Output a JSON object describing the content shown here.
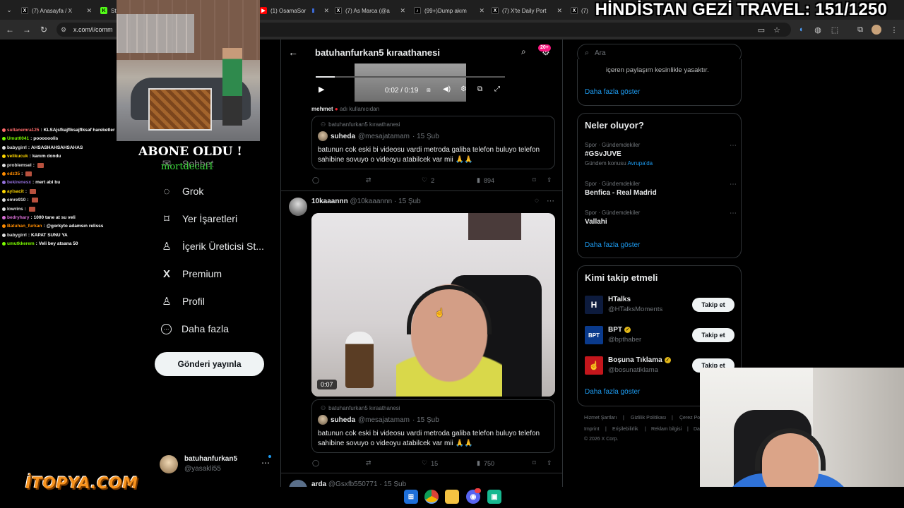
{
  "browser": {
    "tabs": [
      {
        "title": "(7) Anasayfa / X",
        "icon": "x-icon",
        "color": "#000000",
        "glyph": "X"
      },
      {
        "title": "St",
        "icon": "kick-icon",
        "color": "#53fc18",
        "glyph": "K"
      },
      {
        "title": "(1) OsamaSor",
        "icon": "youtube-icon",
        "color": "#ff0000",
        "glyph": "▶"
      },
      {
        "title": "(7) As Marca (@a",
        "icon": "x-icon",
        "color": "#000000",
        "glyph": "X"
      },
      {
        "title": "(99+)Dump akım",
        "icon": "tiktok-icon",
        "color": "#000000",
        "glyph": "♪"
      },
      {
        "title": "(7) X'te Daily Port",
        "icon": "x-icon",
        "color": "#000000",
        "glyph": "X"
      },
      {
        "title": "(7)",
        "icon": "x-icon",
        "color": "#000000",
        "glyph": "X"
      }
    ],
    "url": "x.com/i/comm"
  },
  "overlay": {
    "stream_title": "HİNDİSTAN GEZİ TRAVEL: 151/1250",
    "abone_text": "ABONE OLDU !",
    "abone_name": "mortdecai1",
    "brand_logo": "İTOPYA.COM"
  },
  "chat": [
    {
      "user": "sultanemra125",
      "msg": "KLSAjsfkajflksajflksaf hareketler",
      "color": "#ff6b6b",
      "emote": false
    },
    {
      "user": "Umut0041",
      "msg": "poooooolis",
      "color": "#7cfc00",
      "emote": false
    },
    {
      "user": "babygirrl",
      "msg": "AHSASHAHSAHSAHAS",
      "color": "#e0e0e0",
      "emote": false
    },
    {
      "user": "velikucuk",
      "msg": "kanım dondu",
      "color": "#ffd700",
      "emote": false
    },
    {
      "user": "problemsel",
      "msg": "",
      "color": "#e0e0e0",
      "emote": true
    },
    {
      "user": "edz35",
      "msg": "",
      "color": "#ff8c00",
      "emote": true
    },
    {
      "user": "bekirenesx",
      "msg": "mert abi bu",
      "color": "#9370db",
      "emote": false
    },
    {
      "user": "ayisacit",
      "msg": "",
      "color": "#ffd700",
      "emote": true
    },
    {
      "user": "emre910",
      "msg": "",
      "color": "#e0e0e0",
      "emote": true
    },
    {
      "user": "lowrins",
      "msg": "",
      "color": "#e0e0e0",
      "emote": true
    },
    {
      "user": "bedryhary",
      "msg": "1000 tane at su veli",
      "color": "#da70d6",
      "emote": false
    },
    {
      "user": "Batuhan_furkan",
      "msg": "@gorkyto adamsın relisss",
      "color": "#ff8c00",
      "emote": false
    },
    {
      "user": "babygirrl",
      "msg": "KAPAT SUNU YA",
      "color": "#e0e0e0",
      "emote": false
    },
    {
      "user": "umutkkerem",
      "msg": "Veli bey atsana 50",
      "color": "#7cfc00",
      "emote": false
    }
  ],
  "sidebar": {
    "items": [
      {
        "label": "Sohbet",
        "icon": "mail-icon",
        "glyph": "✉"
      },
      {
        "label": "Grok",
        "icon": "grok-icon",
        "glyph": "◌"
      },
      {
        "label": "Yer İşaretleri",
        "icon": "bookmark-icon",
        "glyph": "⌑"
      },
      {
        "label": "İçerik Üreticisi St...",
        "icon": "creator-icon",
        "glyph": "♙"
      },
      {
        "label": "Premium",
        "icon": "x-premium-icon",
        "glyph": "X"
      },
      {
        "label": "Profil",
        "icon": "profile-icon",
        "glyph": "♙"
      },
      {
        "label": "Daha fazla",
        "icon": "more-circle-icon",
        "glyph": "⋯"
      }
    ],
    "post_button": "Gönderi yayınla",
    "account": {
      "name": "batuhanfurkan5",
      "handle": "@yasakli55"
    }
  },
  "header": {
    "title": "batuhanfurkan5 kıraathanesi",
    "badge": "20+"
  },
  "post1": {
    "video_time": "0:02 / 0:19",
    "progress": 0.1,
    "reply_user": "mehmet",
    "reply_note": "adı kullanıcıdan",
    "community": "batuhanfurkan5 kıraathanesi",
    "quote_name": "suheda",
    "quote_handle": "@mesajatamam",
    "quote_date": "· 15 Şub",
    "quote_text": "batunun cok eski bi videosu vardi metroda galiba telefon buluyo telefon sahibine sovuyo o videoyu atabilcek var mii 🙏🙏",
    "likes": "2",
    "views": "894"
  },
  "post2": {
    "name": "10kaaannn",
    "handle": "@10kaaannn",
    "date": "· 15 Şub",
    "video_duration": "0:07",
    "community": "batuhanfurkan5 kıraathanesi",
    "quote_name": "suheda",
    "quote_handle": "@mesajatamam",
    "quote_date": "· 15 Şub",
    "quote_text": "batunun cok eski bi videosu vardi metroda galiba telefon buluyo telefon sahibine sovuyo o videoyu atabilcek var mii 🙏🙏",
    "likes": "15",
    "views": "750"
  },
  "post3": {
    "name": "arda",
    "handle": "@Gsxfb550771",
    "date": "· 15 Şub"
  },
  "right": {
    "search_placeholder": "Ara",
    "top_text": "içeren paylaşım kesinlikle yasaktır.",
    "show_more": "Daha fazla göster",
    "trends_title": "Neler oluyor?",
    "trends": [
      {
        "meta": "Spor · Gündemdekiler",
        "title": "#GSvJUVE",
        "sub": "Gündem konusu",
        "sub_link": "Avrupa'da"
      },
      {
        "meta": "Spor · Gündemdekiler",
        "title": "Benfica - Real Madrid",
        "sub": "",
        "sub_link": ""
      },
      {
        "meta": "Spor · Gündemdekiler",
        "title": "Vallahi",
        "sub": "",
        "sub_link": ""
      }
    ],
    "who_title": "Kimi takip etmeli",
    "who": [
      {
        "name": "HTalks",
        "handle": "@HTalksMoments",
        "verified": false,
        "logo": "H",
        "bg": "#0d1b3d"
      },
      {
        "name": "BPT",
        "handle": "@bpthaber",
        "verified": true,
        "logo": "BPT",
        "bg": "#0a3a8c"
      },
      {
        "name": "Boşuna Tıklama",
        "handle": "@bosunatiklama",
        "verified": true,
        "logo": "☝",
        "bg": "#c4161c"
      }
    ],
    "follow_label": "Takip et",
    "footer": [
      "Hizmet Şartları",
      "Gizlilik Politikası",
      "Çerez Po",
      "Imprint",
      "Erişilebilirlik",
      "Reklam bilgisi",
      "Da",
      "© 2026 X Corp."
    ]
  }
}
